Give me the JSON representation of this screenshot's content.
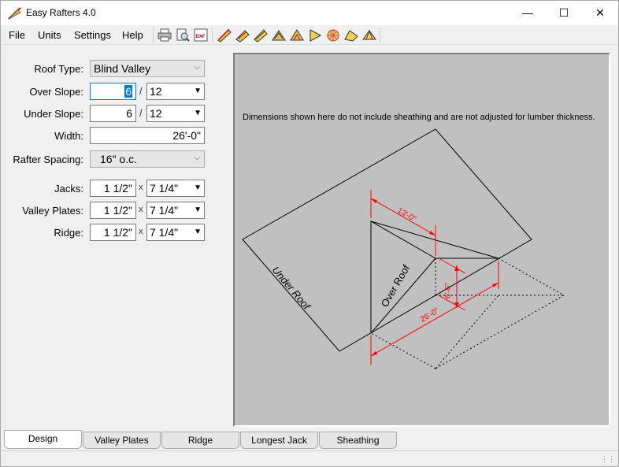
{
  "window": {
    "title": "Easy Rafters 4.0",
    "minimize": "—",
    "maximize": "☐",
    "close": "✕"
  },
  "menu": [
    "File",
    "Units",
    "Settings",
    "Help"
  ],
  "toolbar": {
    "group1": [
      "print-icon",
      "print-preview-icon",
      "dxf-export-icon"
    ],
    "group2": [
      "common-rafter-icon",
      "hip-rafter-icon",
      "valley-rafter-icon",
      "jack-rafter-icon",
      "gable-rafter-icon",
      "blind-valley-icon",
      "polygon-icon",
      "cone-icon",
      "octagon-roof-icon"
    ]
  },
  "form": {
    "roof_type": {
      "label": "Roof Type:",
      "value": "Blind Valley"
    },
    "over_slope": {
      "label": "Over Slope:",
      "value": "6",
      "sep": "/",
      "run": "12"
    },
    "under_slope": {
      "label": "Under Slope:",
      "value": "6",
      "sep": "/",
      "run": "12"
    },
    "width": {
      "label": "Width:",
      "value": "26'-0\""
    },
    "rafter_spacing": {
      "label": "Rafter Spacing:",
      "value": "16\" o.c."
    },
    "jacks": {
      "label": "Jacks:",
      "thick": "1 1/2\"",
      "x": "x",
      "depth": "7 1/4\""
    },
    "valley_plates": {
      "label": "Valley Plates:",
      "thick": "1 1/2\"",
      "x": "x",
      "depth": "7 1/4\""
    },
    "ridge": {
      "label": "Ridge:",
      "thick": "1 1/2\"",
      "x": "x",
      "depth": "7 1/4\""
    }
  },
  "drawing": {
    "note": "Dimensions shown here do not include sheathing and are not adjusted for lumber thickness.",
    "under_roof_label": "Under Roof",
    "over_roof_label": "Over Roof",
    "dim_ridge": "13'-0\"",
    "dim_width": "26'-0\"",
    "dim_rise": "6'-6\"",
    "dim_color": "#ff0000"
  },
  "tabs": [
    "Design",
    "Valley Plates",
    "Ridge",
    "Longest Jack",
    "Sheathing"
  ],
  "active_tab": "Design"
}
